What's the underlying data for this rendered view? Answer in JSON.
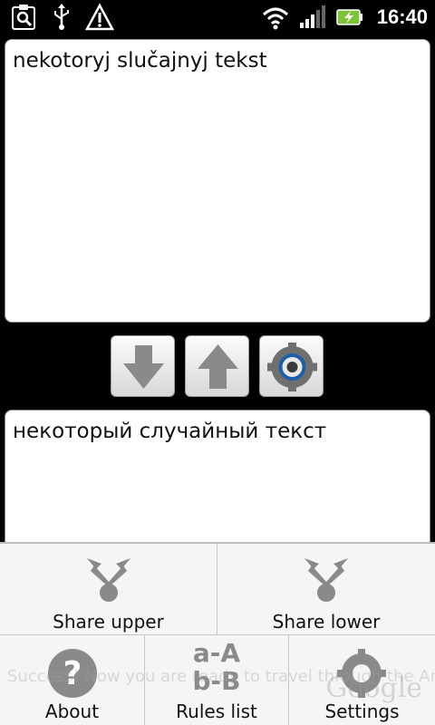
{
  "status_bar": {
    "time": "16:40",
    "icons_left": [
      "search-clip-icon",
      "usb-icon",
      "warning-icon"
    ],
    "icons_right": [
      "wifi-icon",
      "signal-icon",
      "battery-charging-icon"
    ]
  },
  "upper_text": "nekotoryj slučajnyj tekst",
  "lower_text": "некоторый случайный текст",
  "actions": {
    "convert_down_icon": "arrow-down-icon",
    "convert_up_icon": "arrow-up-icon",
    "settings_icon": "gear-icon"
  },
  "menu": {
    "share_upper": "Share upper",
    "share_lower": "Share lower",
    "about": "About",
    "rules_list": "Rules list",
    "settings": "Settings",
    "rules_icon_text_top": "a-A",
    "rules_icon_text_bottom": "b-B"
  },
  "ad_banner": {
    "text": "Success! Now you are ready to travel through the Android sky.",
    "brand": "Google"
  },
  "colors": {
    "accent_green": "#7ec23a",
    "icon_gray": "#8a8a8a"
  }
}
